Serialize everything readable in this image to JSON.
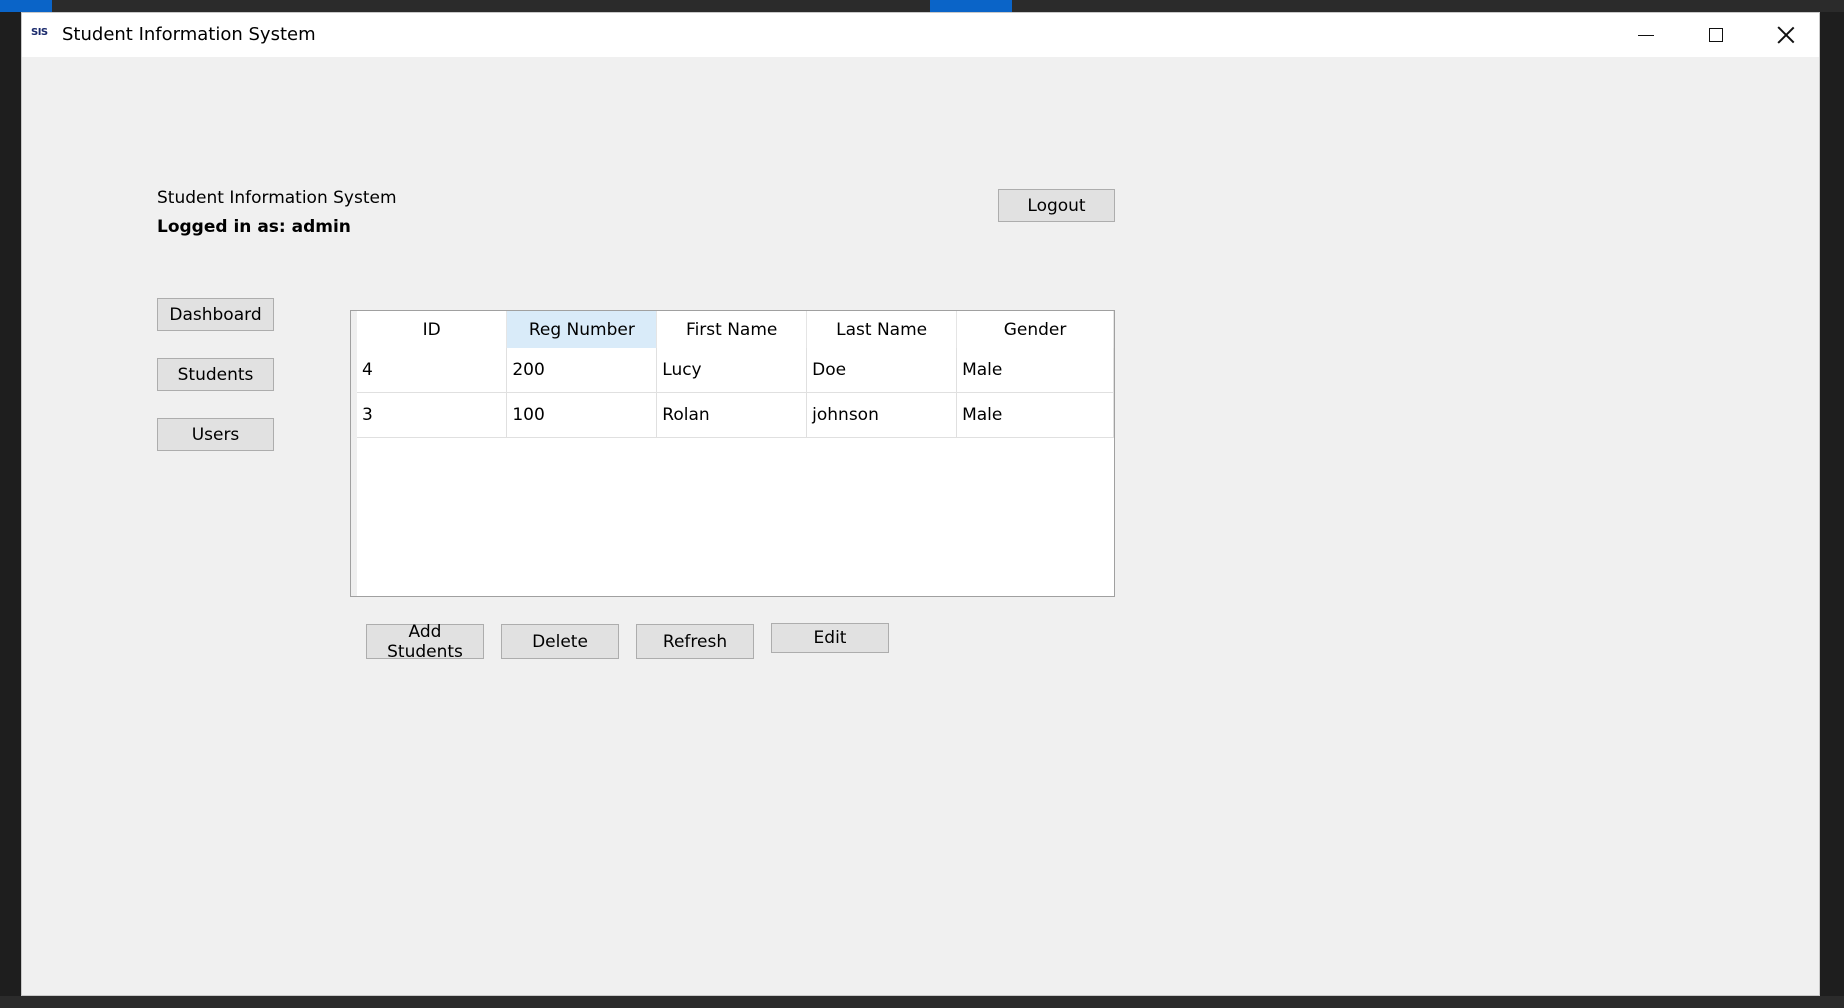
{
  "window": {
    "title": "Student Information System",
    "icon_text": "SIS"
  },
  "header": {
    "system_label": "Student Information System",
    "logged_in_label": "Logged in as: admin",
    "logout_label": "Logout"
  },
  "sidebar": {
    "items": [
      {
        "label": "Dashboard"
      },
      {
        "label": "Students"
      },
      {
        "label": "Users"
      }
    ]
  },
  "table": {
    "columns": [
      "ID",
      "Reg Number",
      "First Name",
      "Last Name",
      "Gender"
    ],
    "sorted_column": "Reg Number",
    "rows": [
      [
        "4",
        "200",
        "Lucy",
        "Doe",
        "Male"
      ],
      [
        "3",
        "100",
        "Rolan",
        "johnson",
        "Male"
      ]
    ]
  },
  "actions": {
    "add_label": "Add Students",
    "delete_label": "Delete",
    "refresh_label": "Refresh",
    "edit_label": "Edit"
  },
  "colors": {
    "window_bg": "#f0f0f0",
    "button_bg": "#e1e1e1",
    "sorted_header_bg": "#d9ebf9"
  }
}
